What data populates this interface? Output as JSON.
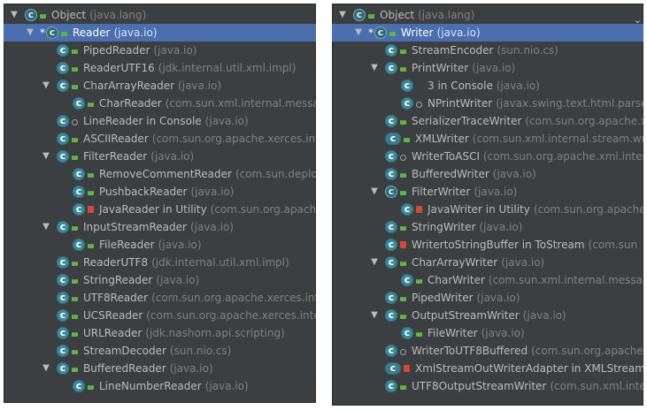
{
  "left_tree": {
    "rows": [
      {
        "depth": 0,
        "arrow": "expanded",
        "icon": "abstract",
        "mod": "public",
        "name": "Object",
        "pkg": "(java.lang)"
      },
      {
        "depth": 1,
        "arrow": "expanded",
        "icon": "abstract",
        "mod": "public",
        "name": "Reader",
        "pkg": "(java.io)",
        "selected": true,
        "star": true
      },
      {
        "depth": 2,
        "arrow": "",
        "icon": "class",
        "mod": "public",
        "name": "PipedReader",
        "pkg": "(java.io)"
      },
      {
        "depth": 2,
        "arrow": "",
        "icon": "class",
        "mod": "public",
        "name": "ReaderUTF16",
        "pkg": "(jdk.internal.util.xml.impl)"
      },
      {
        "depth": 2,
        "arrow": "expanded",
        "icon": "class",
        "mod": "public",
        "name": "CharArrayReader",
        "pkg": "(java.io)"
      },
      {
        "depth": 3,
        "arrow": "",
        "icon": "class",
        "mod": "public",
        "name": "CharReader",
        "pkg": "(com.sun.xml.internal.messag"
      },
      {
        "depth": 2,
        "arrow": "",
        "icon": "class",
        "mod": "package",
        "name": "LineReader in Console",
        "pkg": "(java.io)"
      },
      {
        "depth": 2,
        "arrow": "",
        "icon": "class",
        "mod": "public",
        "name": "ASCIIReader",
        "pkg": "(com.sun.org.apache.xerces.inte"
      },
      {
        "depth": 2,
        "arrow": "expanded",
        "icon": "class",
        "mod": "public",
        "name": "FilterReader",
        "pkg": "(java.io)"
      },
      {
        "depth": 3,
        "arrow": "",
        "icon": "class",
        "mod": "public",
        "name": "RemoveCommentReader",
        "pkg": "(com.sun.deploy"
      },
      {
        "depth": 3,
        "arrow": "",
        "icon": "class",
        "mod": "public",
        "name": "PushbackReader",
        "pkg": "(java.io)"
      },
      {
        "depth": 3,
        "arrow": "",
        "icon": "class",
        "mod": "private",
        "name": "JavaReader in Utility",
        "pkg": "(com.sun.org.apache"
      },
      {
        "depth": 2,
        "arrow": "expanded",
        "icon": "class",
        "mod": "public",
        "name": "InputStreamReader",
        "pkg": "(java.io)"
      },
      {
        "depth": 3,
        "arrow": "",
        "icon": "class",
        "mod": "public",
        "name": "FileReader",
        "pkg": "(java.io)"
      },
      {
        "depth": 2,
        "arrow": "",
        "icon": "class",
        "mod": "public",
        "name": "ReaderUTF8",
        "pkg": "(jdk.internal.util.xml.impl)"
      },
      {
        "depth": 2,
        "arrow": "",
        "icon": "class",
        "mod": "public",
        "name": "StringReader",
        "pkg": "(java.io)"
      },
      {
        "depth": 2,
        "arrow": "",
        "icon": "class",
        "mod": "public",
        "name": "UTF8Reader",
        "pkg": "(com.sun.org.apache.xerces.inte"
      },
      {
        "depth": 2,
        "arrow": "",
        "icon": "class",
        "mod": "public",
        "name": "UCSReader",
        "pkg": "(com.sun.org.apache.xerces.inter"
      },
      {
        "depth": 2,
        "arrow": "",
        "icon": "class",
        "mod": "public",
        "name": "URLReader",
        "pkg": "(jdk.nashorn.api.scripting)"
      },
      {
        "depth": 2,
        "arrow": "",
        "icon": "class",
        "mod": "public",
        "name": "StreamDecoder",
        "pkg": "(sun.nio.cs)"
      },
      {
        "depth": 2,
        "arrow": "expanded",
        "icon": "class",
        "mod": "public",
        "name": "BufferedReader",
        "pkg": "(java.io)"
      },
      {
        "depth": 3,
        "arrow": "",
        "icon": "class",
        "mod": "public",
        "name": "LineNumberReader",
        "pkg": "(java.io)"
      }
    ]
  },
  "right_tree": {
    "rows": [
      {
        "depth": 0,
        "arrow": "expanded",
        "icon": "abstract",
        "mod": "public",
        "name": "Object",
        "pkg": "(java.lang)"
      },
      {
        "depth": 1,
        "arrow": "expanded",
        "icon": "abstract",
        "mod": "public",
        "name": "Writer",
        "pkg": "(java.io)",
        "selected": true,
        "star": true
      },
      {
        "depth": 2,
        "arrow": "",
        "icon": "class",
        "mod": "public",
        "name": "StreamEncoder",
        "pkg": "(sun.nio.cs)"
      },
      {
        "depth": 2,
        "arrow": "expanded",
        "icon": "class",
        "mod": "public",
        "name": "PrintWriter",
        "pkg": "(java.io)"
      },
      {
        "depth": 3,
        "arrow": "",
        "icon": "class",
        "mod": "none",
        "name": "3 in Console",
        "pkg": "(java.io)"
      },
      {
        "depth": 3,
        "arrow": "",
        "icon": "class",
        "mod": "package",
        "name": "NPrintWriter",
        "pkg": "(javax.swing.text.html.parser)"
      },
      {
        "depth": 2,
        "arrow": "",
        "icon": "class",
        "mod": "public",
        "name": "SerializerTraceWriter",
        "pkg": "(com.sun.org.apache.xn"
      },
      {
        "depth": 2,
        "arrow": "",
        "icon": "wide",
        "mod": "public",
        "name": "XMLWriter",
        "pkg": "(com.sun.xml.internal.stream.write"
      },
      {
        "depth": 2,
        "arrow": "",
        "icon": "class",
        "mod": "package",
        "name": "WriterToASCI",
        "pkg": "(com.sun.org.apache.xml.intern"
      },
      {
        "depth": 2,
        "arrow": "",
        "icon": "class",
        "mod": "public",
        "name": "BufferedWriter",
        "pkg": "(java.io)"
      },
      {
        "depth": 2,
        "arrow": "expanded",
        "icon": "abstract",
        "mod": "public",
        "name": "FilterWriter",
        "pkg": "(java.io)"
      },
      {
        "depth": 3,
        "arrow": "",
        "icon": "class",
        "mod": "private",
        "name": "JavaWriter in Utility",
        "pkg": "(com.sun.org.apache.l"
      },
      {
        "depth": 2,
        "arrow": "",
        "icon": "class",
        "mod": "public",
        "name": "StringWriter",
        "pkg": "(java.io)"
      },
      {
        "depth": 2,
        "arrow": "",
        "icon": "class",
        "mod": "private",
        "name": "WritertoStringBuffer in ToStream",
        "pkg": "(com.sun"
      },
      {
        "depth": 2,
        "arrow": "expanded",
        "icon": "class",
        "mod": "public",
        "name": "CharArrayWriter",
        "pkg": "(java.io)"
      },
      {
        "depth": 3,
        "arrow": "",
        "icon": "class",
        "mod": "public",
        "name": "CharWriter",
        "pkg": "(com.sun.xml.internal.messagi"
      },
      {
        "depth": 2,
        "arrow": "",
        "icon": "class",
        "mod": "public",
        "name": "PipedWriter",
        "pkg": "(java.io)"
      },
      {
        "depth": 2,
        "arrow": "expanded",
        "icon": "class",
        "mod": "public",
        "name": "OutputStreamWriter",
        "pkg": "(java.io)"
      },
      {
        "depth": 3,
        "arrow": "",
        "icon": "class",
        "mod": "public",
        "name": "FileWriter",
        "pkg": "(java.io)"
      },
      {
        "depth": 2,
        "arrow": "",
        "icon": "class",
        "mod": "package",
        "name": "WriterToUTF8Buffered",
        "pkg": "(com.sun.org.apache.:"
      },
      {
        "depth": 2,
        "arrow": "",
        "icon": "wide",
        "mod": "private",
        "name": "XmlStreamOutWriterAdapter in XMLStreamW",
        "pkg": ""
      },
      {
        "depth": 2,
        "arrow": "",
        "icon": "class",
        "mod": "public",
        "name": "UTF8OutputStreamWriter",
        "pkg": "(com.sun.xml.intern"
      }
    ]
  },
  "icons": {
    "expanded_glyph": "▼",
    "collapsed_glyph": "▶",
    "star_glyph": "*",
    "edge_glyph": "⌄"
  },
  "colors": {
    "panel_bg": "#3c3f41",
    "selection": "#4b6eaf",
    "text": "#bbbbbb",
    "package_text": "#808080",
    "class_icon": "#3d8a9b",
    "public_mod": "#62b543",
    "private_mod": "#d6483b"
  }
}
